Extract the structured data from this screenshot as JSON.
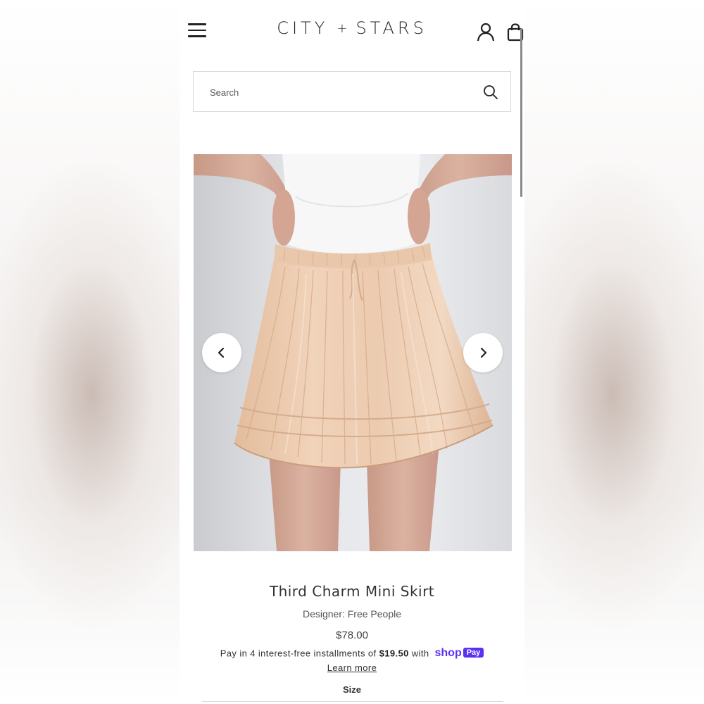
{
  "header": {
    "brand_left": "CITY",
    "brand_plus": "+",
    "brand_right": "STARS",
    "menu_icon": "hamburger-menu-icon",
    "account_icon": "user-icon",
    "cart_icon": "shopping-bag-icon"
  },
  "search": {
    "placeholder": "Search",
    "icon": "search-icon"
  },
  "gallery": {
    "prev_icon": "chevron-left-icon",
    "next_icon": "chevron-right-icon"
  },
  "product": {
    "title": "Third Charm Mini Skirt",
    "designer": "Designer: Free People",
    "price": "$78.00",
    "installments_prefix": "Pay in 4 interest-free installments of",
    "installment_amount": "$19.50",
    "installments_with": "with",
    "shop_pay_shop": "shop",
    "shop_pay_pay": "Pay",
    "learn_more": "Learn more",
    "size_label": "Size"
  },
  "colors": {
    "shop_pay_brand": "#5a31f4",
    "text_primary": "#333333",
    "skirt": "#e8c4a6"
  }
}
